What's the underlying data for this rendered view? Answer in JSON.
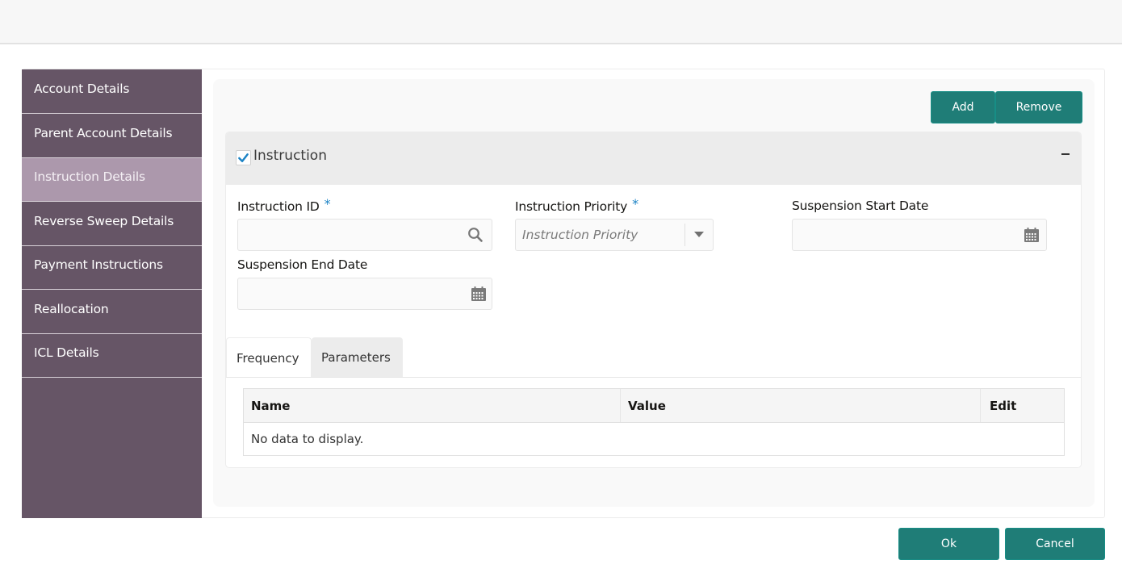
{
  "sidebar": {
    "items": [
      {
        "label": "Account Details",
        "active": false
      },
      {
        "label": "Parent Account Details",
        "active": false
      },
      {
        "label": "Instruction Details",
        "active": true
      },
      {
        "label": "Reverse Sweep Details",
        "active": false
      },
      {
        "label": "Payment Instructions",
        "active": false
      },
      {
        "label": "Reallocation",
        "active": false
      },
      {
        "label": "ICL Details",
        "active": false
      }
    ]
  },
  "toolbar": {
    "add_label": "Add",
    "remove_label": "Remove"
  },
  "panel": {
    "title": "Instruction",
    "checked": true,
    "collapse_icon": "minus-icon"
  },
  "fields": {
    "instruction_id": {
      "label": "Instruction ID",
      "required_mark": "*",
      "value": "",
      "icon": "search-icon"
    },
    "instruction_priority": {
      "label": "Instruction Priority",
      "required_mark": "*",
      "placeholder": "Instruction Priority",
      "icon": "caret-down-icon"
    },
    "suspension_start_date": {
      "label": "Suspension Start Date",
      "value": "",
      "icon": "calendar-icon"
    },
    "suspension_end_date": {
      "label": "Suspension End Date",
      "value": "",
      "icon": "calendar-icon"
    }
  },
  "tabs": [
    {
      "label": "Frequency",
      "active": true
    },
    {
      "label": "Parameters",
      "active": false
    }
  ],
  "table": {
    "columns": [
      "Name",
      "Value",
      "Edit"
    ],
    "empty_message": "No data to display."
  },
  "footer": {
    "ok_label": "Ok",
    "cancel_label": "Cancel"
  },
  "colors": {
    "sidebar_bg": "#665566",
    "sidebar_active": "#ac98ac",
    "button_primary": "#1f7d77",
    "required_mark": "#1c83c5",
    "checkbox_check": "#1c83c5"
  }
}
